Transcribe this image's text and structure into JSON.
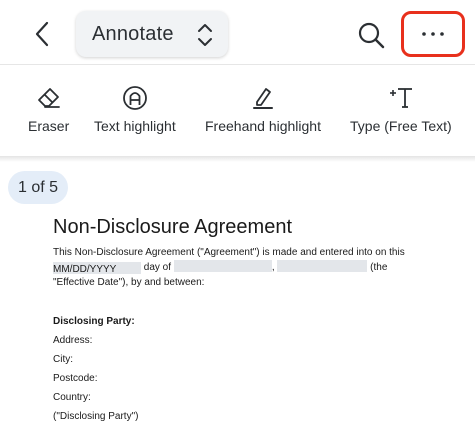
{
  "header": {
    "mode_label": "Annotate"
  },
  "toolbar": {
    "tools": [
      {
        "label": "Eraser",
        "icon": "eraser-icon"
      },
      {
        "label": "Text highlight",
        "icon": "text-highlight-icon"
      },
      {
        "label": "Freehand highlight",
        "icon": "freehand-highlight-icon"
      },
      {
        "label": "Type (Free Text)",
        "icon": "free-text-icon"
      }
    ]
  },
  "viewer": {
    "page_indicator": "1 of 5"
  },
  "document": {
    "title": "Non-Disclosure Agreement",
    "intro_line1": "This Non-Disclosure Agreement (\"Agreement\") is made and entered into on this",
    "date_placeholder": "MM/DD/YYYY",
    "day_of": "day of",
    "comma": ",",
    "the": "(the",
    "effective_date": "\"Effective Date\"), by and between:",
    "disclosing_party_heading": "Disclosing Party:",
    "address_label": "Address:",
    "city_label": "City:",
    "postcode_label": "Postcode:",
    "country_label": "Country:",
    "party_ref": "(\"Disclosing Party\")"
  },
  "colors": {
    "highlight_ring": "#e8301c",
    "page_badge_bg": "#e4edf8",
    "field_bg": "#e3e6ea"
  }
}
